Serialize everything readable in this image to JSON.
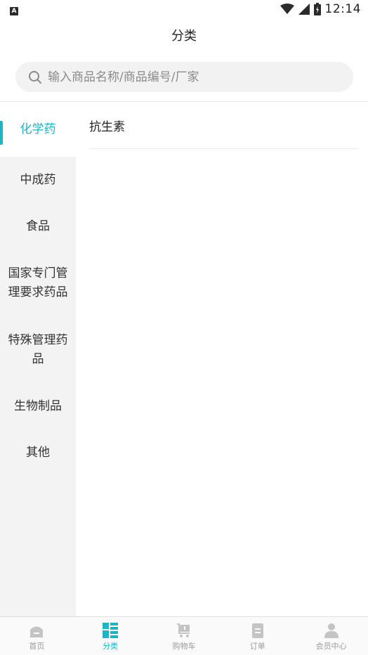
{
  "status_bar": {
    "time": "12:14",
    "notification_icon": "A"
  },
  "header": {
    "title": "分类"
  },
  "search": {
    "placeholder": "输入商品名称/商品编号/厂家"
  },
  "sidebar": {
    "items": [
      {
        "label": "化学药",
        "active": true
      },
      {
        "label": "中成药",
        "active": false
      },
      {
        "label": "食品",
        "active": false
      },
      {
        "label": "国家专门管理要求药品",
        "active": false
      },
      {
        "label": "特殊管理药品",
        "active": false
      },
      {
        "label": "生物制品",
        "active": false
      },
      {
        "label": "其他",
        "active": false
      }
    ]
  },
  "content": {
    "subcategories": [
      {
        "label": "抗生素"
      }
    ]
  },
  "tabbar": {
    "tabs": [
      {
        "label": "首页",
        "icon": "home-icon",
        "active": false
      },
      {
        "label": "分类",
        "icon": "category-icon",
        "active": true
      },
      {
        "label": "购物车",
        "icon": "cart-icon",
        "active": false
      },
      {
        "label": "订单",
        "icon": "order-icon",
        "active": false
      },
      {
        "label": "会员中心",
        "icon": "member-icon",
        "active": false
      }
    ]
  },
  "colors": {
    "accent": "#1fb3c4",
    "inactive": "#c4c4c4"
  }
}
